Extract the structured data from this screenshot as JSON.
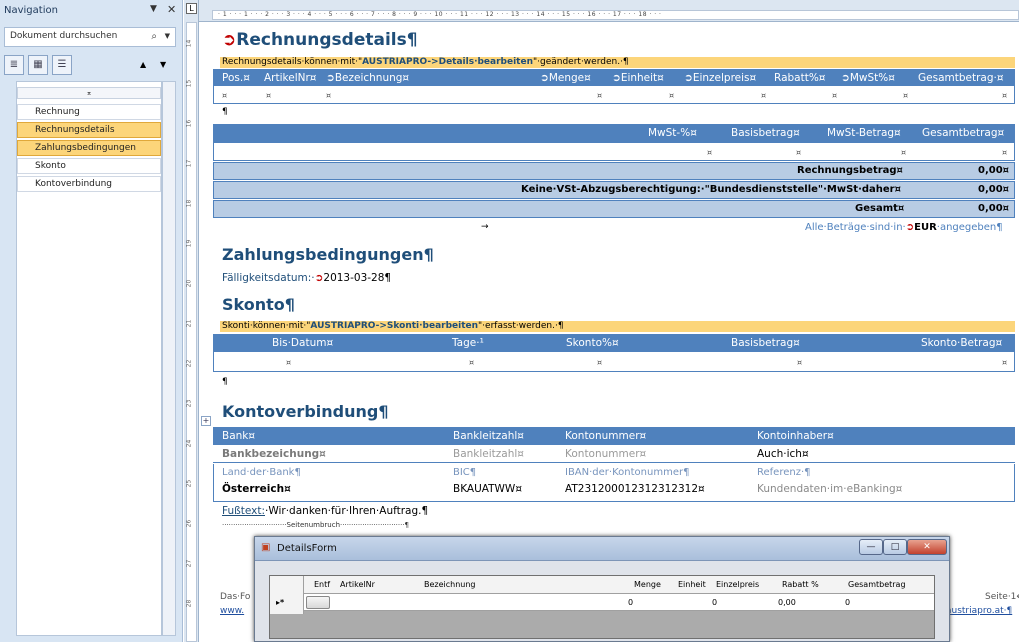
{
  "nav": {
    "title": "Navigation",
    "search_placeholder": "Dokument durchsuchen",
    "items": [
      "Rechnung",
      "Rechnungsdetails",
      "Zahlungsbedingungen",
      "Skonto",
      "Kontoverbindung"
    ]
  },
  "ruler": {
    "h_marks": "· 1 · · · 1 · · · 2 · · · 3 · · · 4 · · · 5 · · · 6 · · · 7 · · · 8 · · · 9 · · · 10 · · · 11 · · · 12 · · · 13 · · · 14 · · · 15 · · · 16 · · · 17 · · · 18 · · ·",
    "v_marks": [
      "14",
      "15",
      "16",
      "17",
      "18",
      "19",
      "20",
      "21",
      "22",
      "23",
      "24",
      "25",
      "26",
      "27",
      "28"
    ]
  },
  "doc": {
    "h_rechnungsdetails": "Rechnungsdetails¶",
    "note1_pre": "Rechnungsdetails·können·mit·\"",
    "note1_bold": "AUSTRIAPRO->Details·bearbeiten",
    "note1_post": "\"·geändert·werden.·¶",
    "detail_cols": [
      "Pos.¤",
      "ArtikelNr¤",
      "Bezeichnung¤",
      "Menge¤",
      "Einheit¤",
      "Einzelpreis¤",
      "Rabatt%¤",
      "MwSt%¤",
      "Gesamtbetrag·¤"
    ],
    "mwst_cols": [
      "MwSt-%¤",
      "Basisbetrag¤",
      "MwSt-Betrag¤",
      "Gesamtbetrag¤"
    ],
    "sum_rows": [
      {
        "label": "Rechnungsbetrag¤",
        "value": "0,00¤"
      },
      {
        "label": "Keine·VSt-Abzugsberechtigung:·\"Bundesdienststelle\"·MwSt·daher¤",
        "value": "0,00¤"
      },
      {
        "label": "Gesamt¤",
        "value": "0,00¤"
      }
    ],
    "currency_pre": "Alle·Beträge·sind·in·",
    "currency": "EUR",
    "currency_post": "·angegeben¶",
    "h_zahlung": "Zahlungsbedingungen¶",
    "faellig_label": "Fälligkeitsdatum:·",
    "faellig_value": "2013-03-28¶",
    "h_skonto": "Skonto¶",
    "note2_pre": "Skonti·können·mit·\"",
    "note2_bold": "AUSTRIAPRO->Skonti·bearbeiten",
    "note2_post": "\"·erfasst·werden.·¶",
    "skonto_cols": [
      "Bis·Datum¤",
      "Tage·¹",
      "Skonto%¤",
      "Basisbetrag¤",
      "Skonto·Betrag¤"
    ],
    "h_konto": "Kontoverbindung¶",
    "konto_head": [
      "Bank¤",
      "Bankleitzahl¤",
      "Kontonummer¤",
      "Kontoinhaber¤"
    ],
    "konto_row1": [
      "Bankbezeichung¤",
      "Bankleitzahl¤",
      "Kontonummer¤",
      "Auch·ich¤"
    ],
    "konto_row2": [
      "Land·der·Bank¶",
      "BIC¶",
      "IBAN·der·Kontonummer¶",
      "Referenz·¶"
    ],
    "konto_row3": [
      "Österreich¤",
      "BKAUATWW¤",
      "AT231200012312312312¤",
      "Kundendaten·im·eBanking¤"
    ],
    "fusstext_label": "Fußtext:",
    "fusstext_value": "·Wir·danken·für·Ihren·Auftrag.¶",
    "pagebreak": "Seitenumbruch",
    "footer_left1": "Das·Fo",
    "footer_left2": "www.",
    "footer_right1": "Seite·1↵",
    "footer_right2": "austriapro.at·¶",
    "pilcrow": "¶"
  },
  "form": {
    "title": "DetailsForm",
    "columns": [
      "Entf",
      "ArtikelNr",
      "Bezeichnung",
      "Menge",
      "Einheit",
      "Einzelpreis",
      "Rabatt %",
      "Gesamtbetrag"
    ],
    "row": {
      "marker": "▸*",
      "menge": "0",
      "einzelpreis": "0",
      "rabatt": "0,00",
      "gesamt": "0"
    }
  }
}
